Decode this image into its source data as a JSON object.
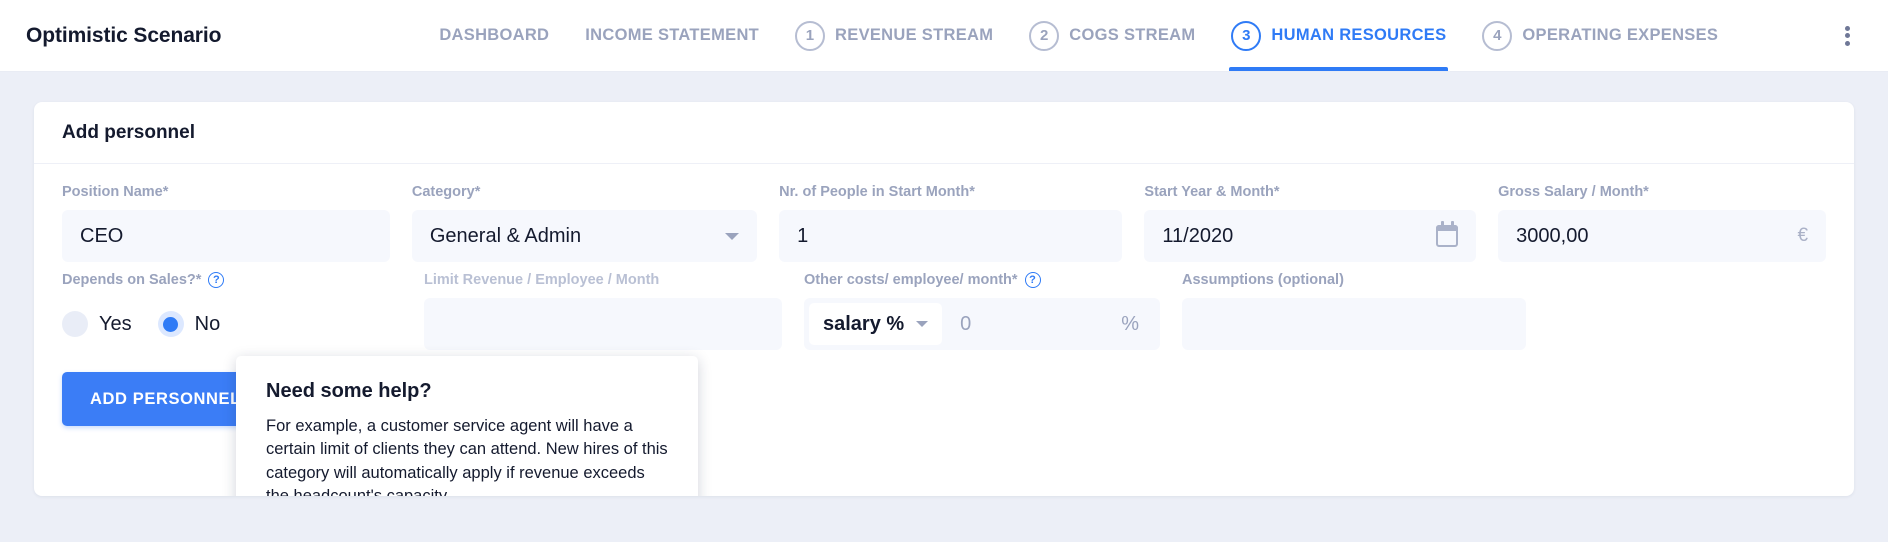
{
  "header": {
    "title": "Optimistic Scenario",
    "menu_icon": "kebab-menu-icon",
    "tabs": [
      {
        "num": "",
        "label": "DASHBOARD",
        "active": false
      },
      {
        "num": "",
        "label": "INCOME STATEMENT",
        "active": false
      },
      {
        "num": "1",
        "label": "REVENUE STREAM",
        "active": false
      },
      {
        "num": "2",
        "label": "COGS STREAM",
        "active": false
      },
      {
        "num": "3",
        "label": "HUMAN RESOURCES",
        "active": true
      },
      {
        "num": "4",
        "label": "OPERATING EXPENSES",
        "active": false
      }
    ]
  },
  "card": {
    "title": "Add personnel",
    "fields": {
      "position_name": {
        "label": "Position Name*",
        "value": "CEO"
      },
      "category": {
        "label": "Category*",
        "value": "General & Admin",
        "icon": "chevron-down-icon"
      },
      "nr_people": {
        "label": "Nr. of People in Start Month*",
        "value": "1"
      },
      "start_month": {
        "label": "Start Year & Month*",
        "value": "11/2020",
        "icon": "calendar-icon"
      },
      "gross_salary": {
        "label": "Gross Salary / Month*",
        "value": "3000,00",
        "suffix": "€"
      },
      "depends_sales": {
        "label": "Depends on Sales?*",
        "help": "?",
        "options": [
          {
            "label": "Yes",
            "selected": false
          },
          {
            "label": "No",
            "selected": true
          }
        ]
      },
      "limit_revenue": {
        "label": "Limit Revenue / Employee / Month",
        "value": ""
      },
      "other_costs": {
        "label": "Other costs/ employee/ month*",
        "help": "?",
        "mode": "salary %",
        "amount": "0",
        "unit": "%",
        "icon": "chevron-down-icon"
      },
      "assumptions": {
        "label": "Assumptions (optional)",
        "value": ""
      }
    },
    "submit_label": "ADD PERSONNEL"
  },
  "tooltip": {
    "title": "Need some help?",
    "body": "For example, a customer service agent will have a certain limit of clients they can attend. New hires of this category will automatically apply if revenue exceeds the headcount's capacity."
  },
  "colors": {
    "accent": "#2f7bf6",
    "button": "#3b7df6",
    "text": "#141a2e",
    "muted": "#9aa3bd",
    "field_bg": "#f6f8fd",
    "page_bg": "#eceff7"
  }
}
